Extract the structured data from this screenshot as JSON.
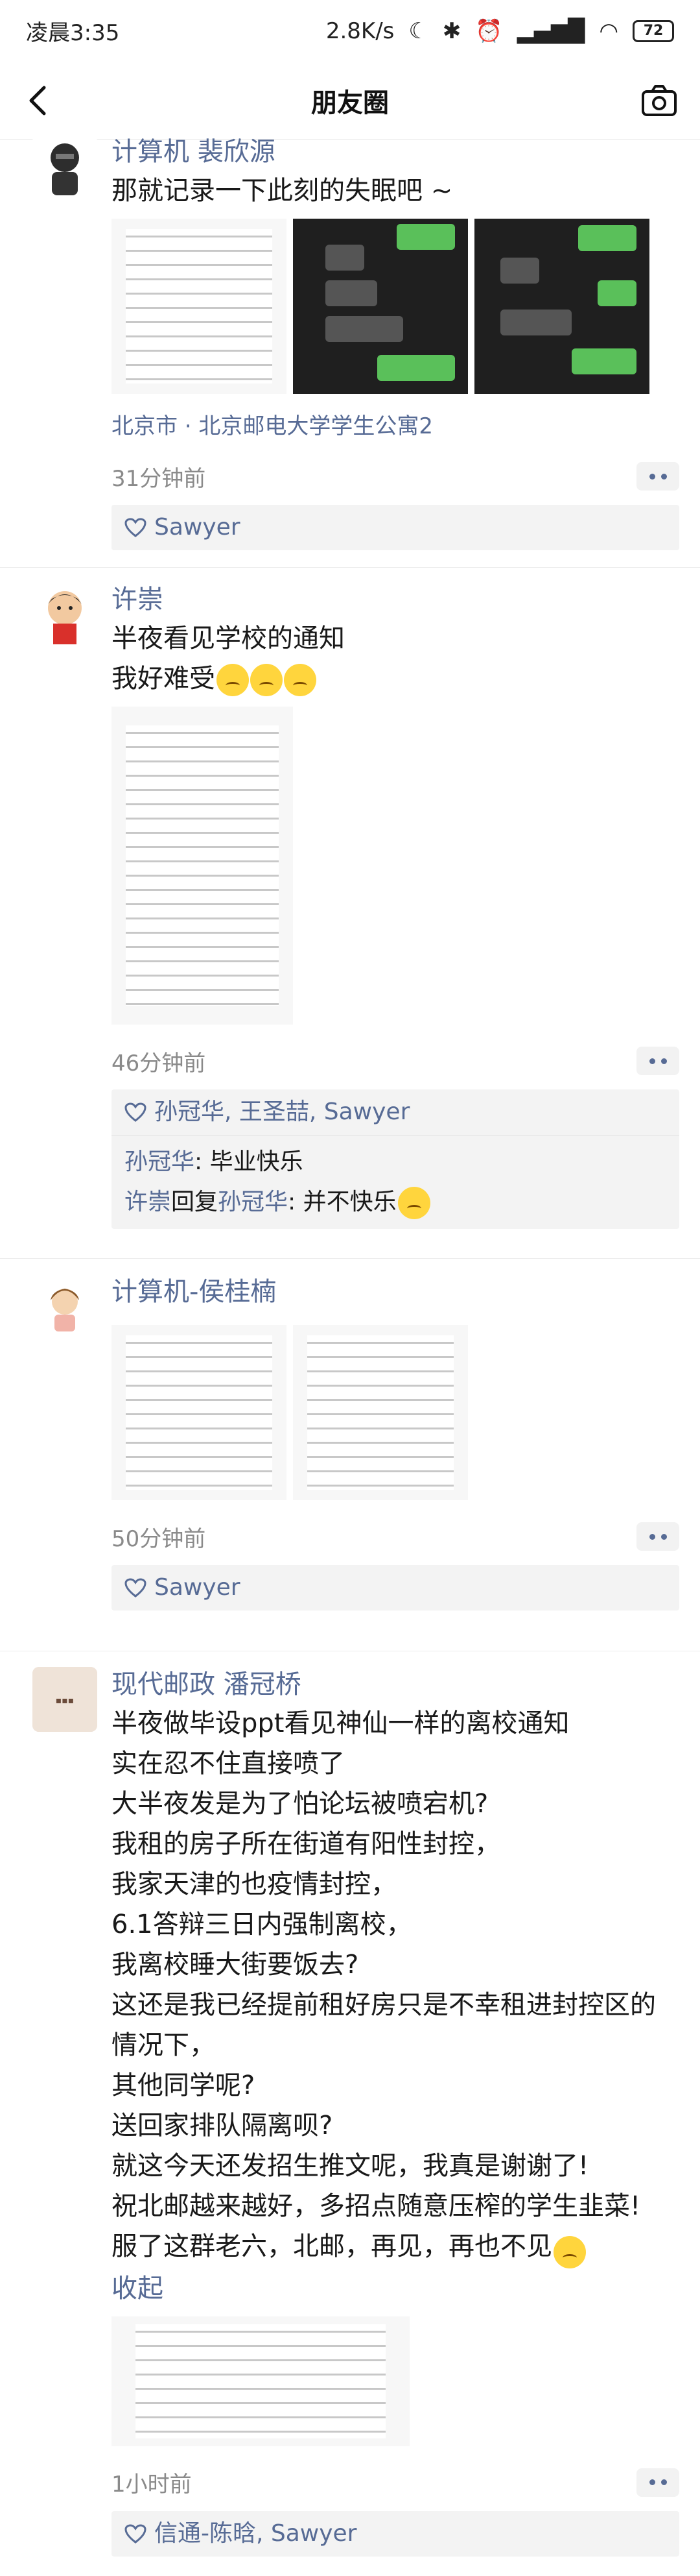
{
  "status": {
    "time": "凌晨3:35",
    "speed": "2.8K/s",
    "battery": "72"
  },
  "nav": {
    "title": "朋友圈"
  },
  "posts": [
    {
      "name": "计算机 裴欣源",
      "text": "那就记录一下此刻的失眠吧 ~",
      "location": "北京市 · 北京邮电大学学生公寓2",
      "time": "31分钟前",
      "likes": "Sawyer"
    },
    {
      "name": "许崇",
      "text_lines": [
        "半夜看见学校的通知",
        "我好难受"
      ],
      "time": "46分钟前",
      "likes": "孙冠华, 王圣喆, Sawyer",
      "comments": [
        {
          "user": "孙冠华",
          "text": ": 毕业快乐"
        },
        {
          "user": "许崇",
          "reply": "回复",
          "target": "孙冠华",
          "text": ": 并不快乐"
        }
      ]
    },
    {
      "name": "计算机-侯桂楠",
      "time": "50分钟前",
      "likes": "Sawyer"
    },
    {
      "name": "现代邮政 潘冠桥",
      "text": "半夜做毕设ppt看见神仙一样的离校通知\n实在忍不住直接喷了\n大半夜发是为了怕论坛被喷宕机?\n我租的房子所在街道有阳性封控，\n我家天津的也疫情封控，\n6.1答辩三日内强制离校，\n我离校睡大街要饭去?\n这还是我已经提前租好房只是不幸租进封控区的情况下，\n其他同学呢?\n送回家排队隔离呗?\n就这今天还发招生推文呢，我真是谢谢了!\n祝北邮越来越好，多招点随意压榨的学生韭菜!\n服了这群老六，北邮，再见，再也不见",
      "collapse": "收起",
      "time": "1小时前",
      "likes": "信通-陈晗, Sawyer"
    }
  ]
}
